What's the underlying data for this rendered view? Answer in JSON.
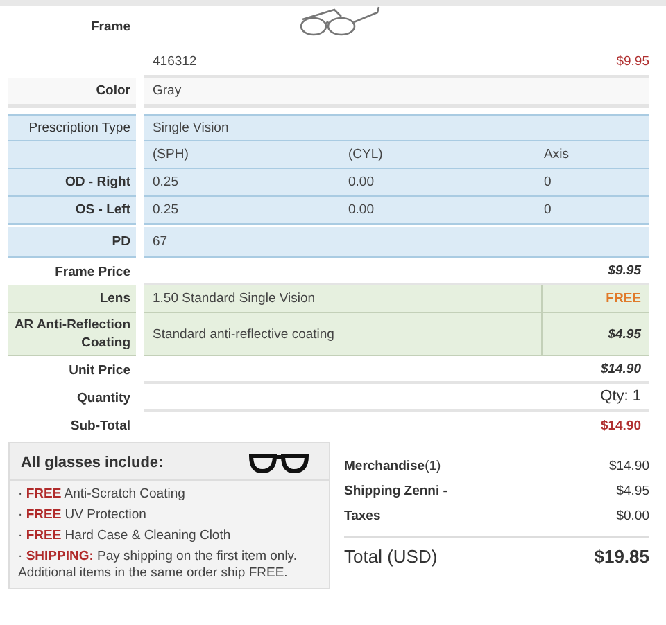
{
  "frame": {
    "label": "Frame",
    "sku": "416312",
    "price": "$9.95",
    "highlighted": true
  },
  "color": {
    "label": "Color",
    "value": "Gray"
  },
  "prescription": {
    "type_label": "Prescription Type",
    "type_value": "Single Vision",
    "columns": [
      "(SPH)",
      "(CYL)",
      "Axis"
    ],
    "rows": [
      {
        "label": "OD - Right",
        "values": [
          "0.25",
          "0.00",
          "0"
        ]
      },
      {
        "label": "OS - Left",
        "values": [
          "0.25",
          "0.00",
          "0"
        ]
      }
    ],
    "pd": {
      "label": "PD",
      "value": "67"
    }
  },
  "pricing": [
    {
      "kind": "total",
      "label": "Frame Price",
      "price": "$9.95",
      "highlighted": false,
      "italic": true
    },
    {
      "kind": "lens",
      "label": "Lens",
      "description": "1.50 Standard Single Vision",
      "price": "FREE",
      "highlighted": true,
      "italic": false
    },
    {
      "kind": "lens",
      "label": "AR Anti-Reflection Coating",
      "description": "Standard anti-reflective coating",
      "price": "$4.95",
      "highlighted": false,
      "italic": true
    },
    {
      "kind": "total",
      "label": "Unit Price",
      "price": "$14.90",
      "highlighted": false,
      "italic": true
    },
    {
      "kind": "qty",
      "label": "Quantity",
      "price": "Qty: 1",
      "highlighted": false,
      "italic": false
    },
    {
      "kind": "total",
      "label": "Sub-Total",
      "price": "$14.90",
      "highlighted": true,
      "italic": false
    }
  ],
  "includes": {
    "title": "All glasses include:",
    "items": [
      "· **FREE** Anti-Scratch Coating",
      "· **FREE** UV Protection",
      "· **FREE** Hard Case & Cleaning Cloth",
      "· **SHIPPING:** Pay shipping on the first item only. Additional items in the same order ship FREE."
    ]
  },
  "summary": {
    "rows": [
      {
        "label": "**Merchandise**(1)",
        "value": "$14.90"
      },
      {
        "label": "**Shipping Zenni -**",
        "value": "$4.95"
      },
      {
        "label": "**Taxes**",
        "value": "$0.00"
      }
    ],
    "total": {
      "label": "Total (USD)",
      "value": "$19.85"
    }
  }
}
